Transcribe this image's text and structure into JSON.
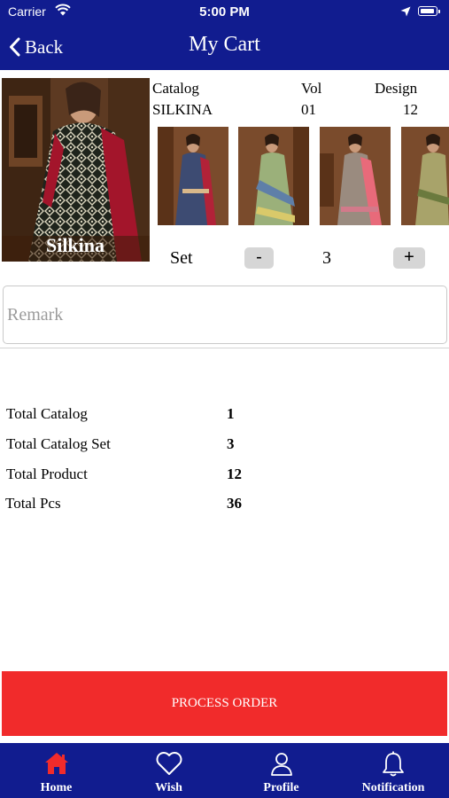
{
  "status_bar": {
    "carrier": "Carrier",
    "time": "5:00 PM"
  },
  "nav": {
    "back_label": "Back",
    "title": "My Cart"
  },
  "catalog": {
    "cover_text": "Silkina",
    "headers": {
      "catalog": "Catalog",
      "vol": "Vol",
      "design": "Design"
    },
    "values": {
      "catalog": "SILKINA",
      "vol": "01",
      "design": "12"
    }
  },
  "set": {
    "label": "Set",
    "decrement": "-",
    "quantity": "3",
    "increment": "+"
  },
  "remark": {
    "placeholder": "Remark",
    "value": ""
  },
  "totals": [
    {
      "label": "Total Catalog",
      "value": "1"
    },
    {
      "label": "Total Catalog Set",
      "value": "3"
    },
    {
      "label": "Total Product",
      "value": "12"
    },
    {
      "label": "Total Pcs",
      "value": "36"
    }
  ],
  "process_order": {
    "label": "PROCESS ORDER"
  },
  "tabs": [
    {
      "label": "Home",
      "icon": "home-icon",
      "active": true
    },
    {
      "label": "Wish",
      "icon": "heart-icon",
      "active": false
    },
    {
      "label": "Profile",
      "icon": "person-icon",
      "active": false
    },
    {
      "label": "Notification",
      "icon": "bell-icon",
      "active": false
    }
  ],
  "colors": {
    "nav_background": "#111c8f",
    "process_button": "#f12b2b",
    "active_tab_icon": "#f12b2b",
    "text": "#000000"
  }
}
